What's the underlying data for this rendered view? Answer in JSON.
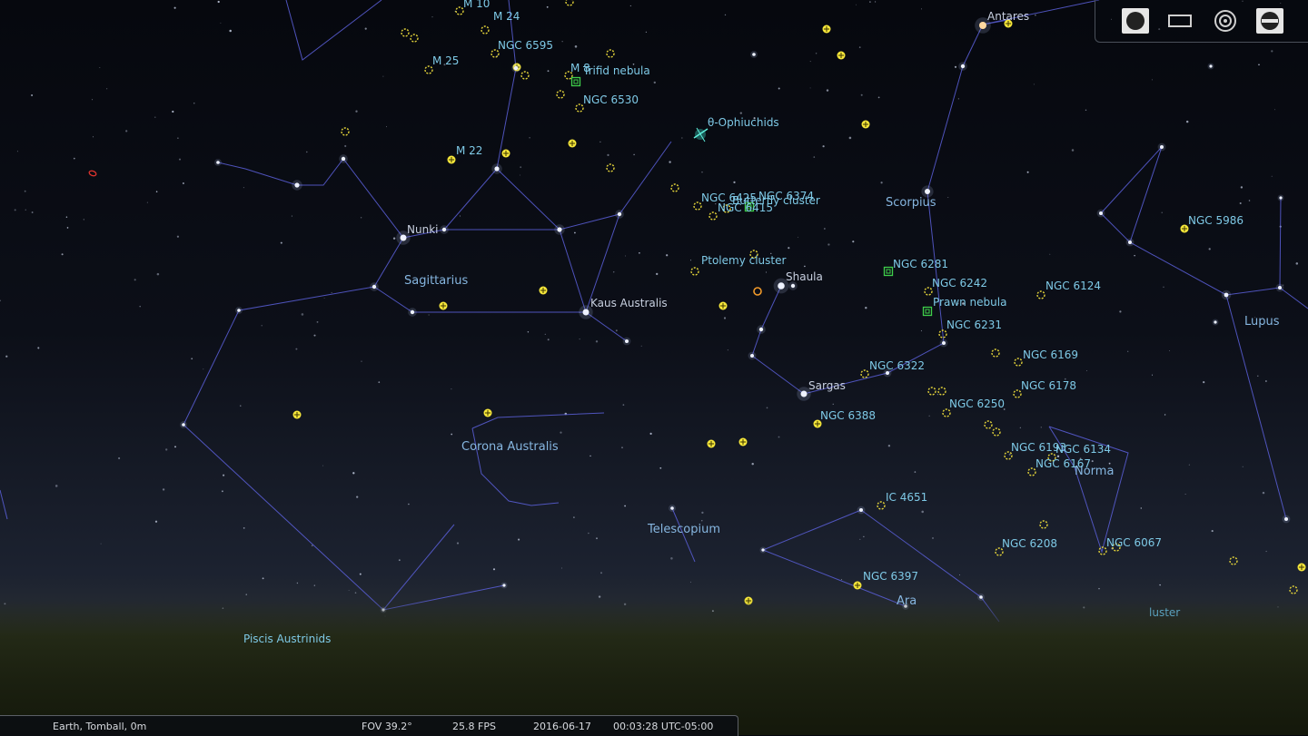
{
  "status": {
    "location": "Earth, Tomball, 0m",
    "fov": "FOV 39.2°",
    "fps": "25.8 FPS",
    "date": "2016-06-17",
    "time": "00:03:28 UTC-05:00"
  },
  "toolbar": {
    "buttons": [
      {
        "icon": "full-moon-icon"
      },
      {
        "icon": "rectangle-icon"
      },
      {
        "icon": "target-icon"
      },
      {
        "icon": "telescope-icon"
      }
    ]
  },
  "constellations": {
    "sagittarius": "Sagittarius",
    "scorpius": "Scorpius",
    "lupus": "Lupus",
    "corona_australis": "Corona Australis",
    "telescopium": "Telescopium",
    "ara": "Ara",
    "norma": "Norma"
  },
  "stars": {
    "nunki": "Nunki",
    "kaus_australis": "Kaus Australis",
    "shaula": "Shaula",
    "sargas": "Sargas",
    "antares": "Antares"
  },
  "objects": {
    "m10": "M 10",
    "m24": "M 24",
    "ngc6595": "NGC 6595",
    "m25": "M 25",
    "m8": "M 8",
    "trifid": "Trifid nebula",
    "ngc6530": "NGC 6530",
    "m22": "M 22",
    "ophiuchids": "θ-Ophiuchids",
    "ngc6425": "NGC 6425",
    "ngc6374": "NGC 6374",
    "butterfly": "Butterfly cluster",
    "ngc6415": "NGC 6415",
    "ptolemy": "Ptolemy cluster",
    "ngc6281": "NGC 6281",
    "ngc6242": "NGC 6242",
    "prawn": "Prawn nebula",
    "ngc6231": "NGC 6231",
    "ngc6322": "NGC 6322",
    "ngc6388": "NGC 6388",
    "ngc5986": "NGC 5986",
    "ngc6124": "NGC 6124",
    "ngc6169": "NGC 6169",
    "ngc6178": "NGC 6178",
    "ngc6250": "NGC 6250",
    "ngc6193": "NGC 6193",
    "ngc6134": "NGC 6134",
    "ngc6167": "NGC 6167",
    "ic4651": "IC 4651",
    "ngc6208": "NGC 6208",
    "ngc6067": "NGC 6067",
    "ngc6397": "NGC 6397",
    "cluster_partial": "luster",
    "piscis_austrinids": "Piscis Austrinids"
  }
}
